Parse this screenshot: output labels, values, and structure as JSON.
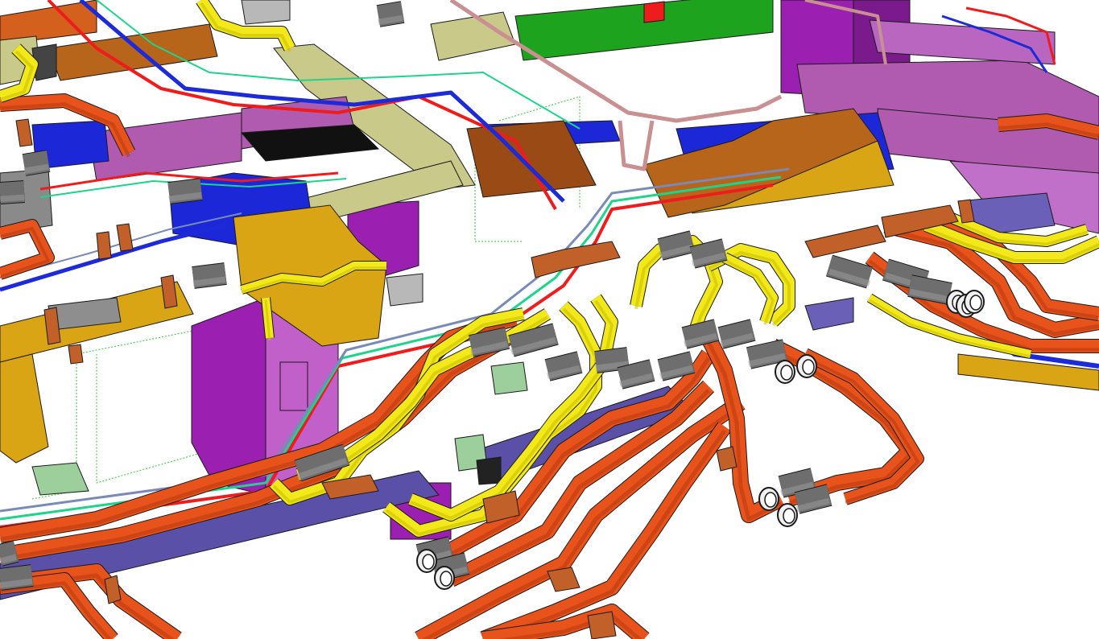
{
  "scene": {
    "kind": "3d-mep-model-viewport",
    "background": "#ffffff",
    "colors": {
      "outline": "#1a1a1a",
      "hot_pipe_orange": "#e8531c",
      "hot_pipe_shade": "#b63a10",
      "yellow_pipe": "#f2e81a",
      "yellow_pipe_shade": "#c7bd00",
      "grey_sleeve": "#6e6e6e",
      "grey_sleeve_light": "#9a9a9a",
      "white_end_cap": "#f0f0f0",
      "supply_duct_blue": "#1c28d8",
      "return_duct_purple": "#b05bb0",
      "exhaust_duct_olive": "#c9c98a",
      "yellow_duct": "#d9a514",
      "brown_duct": "#b8651c",
      "green_duct": "#1ea31e",
      "violet_beam": "#5b50a8",
      "magenta_unit": "#9b1fb0",
      "pale_green_box": "#9ccf9c",
      "cable_red": "#ee1c1c",
      "cable_green": "#1ed38a",
      "cable_blue": "#1c2ad8",
      "cable_slate": "#7a8ab8",
      "pink_pipe": "#c89090",
      "copper_support": "#c2602a",
      "dark_grey_unit": "#444444",
      "light_grey_unit": "#b8b8b8",
      "hidden_edge": "#3bbf3b"
    },
    "systems": [
      "orange-hot-water-pipe",
      "yellow-pipe",
      "grey-insulated-sleeve",
      "blue-supply-duct",
      "purple-return-duct",
      "olive-exhaust-duct",
      "yellow-air-duct",
      "brown-air-duct",
      "green-duct",
      "violet-structural-beam",
      "magenta-air-handling-unit",
      "cable-tray-lines",
      "pink-drain-pipe",
      "copper-pipe-supports"
    ]
  }
}
